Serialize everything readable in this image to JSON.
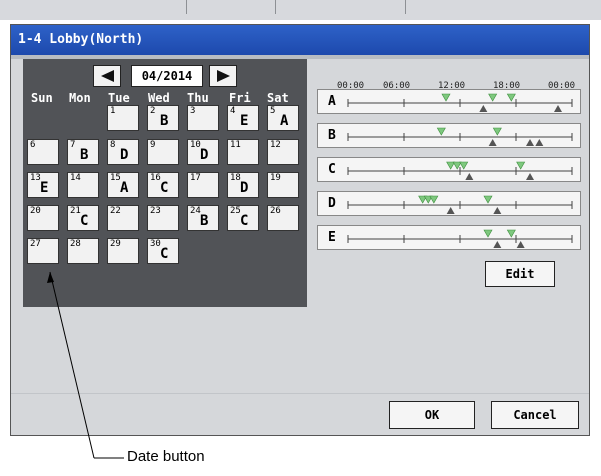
{
  "window": {
    "title": "1-4 Lobby(North)"
  },
  "calendar": {
    "month": "04/2014",
    "prev_icon": "left-triangle-icon",
    "next_icon": "right-triangle-icon",
    "weekdays": [
      "Sun",
      "Mon",
      "Tue",
      "Wed",
      "Thu",
      "Fri",
      "Sat"
    ],
    "days": [
      {
        "num": "1",
        "pattern": ""
      },
      {
        "num": "2",
        "pattern": "B"
      },
      {
        "num": "3",
        "pattern": ""
      },
      {
        "num": "4",
        "pattern": "E"
      },
      {
        "num": "5",
        "pattern": "A"
      },
      {
        "num": "6",
        "pattern": ""
      },
      {
        "num": "7",
        "pattern": "B"
      },
      {
        "num": "8",
        "pattern": "D"
      },
      {
        "num": "9",
        "pattern": ""
      },
      {
        "num": "10",
        "pattern": "D"
      },
      {
        "num": "11",
        "pattern": ""
      },
      {
        "num": "12",
        "pattern": ""
      },
      {
        "num": "13",
        "pattern": "E"
      },
      {
        "num": "14",
        "pattern": ""
      },
      {
        "num": "15",
        "pattern": "A"
      },
      {
        "num": "16",
        "pattern": "C"
      },
      {
        "num": "17",
        "pattern": ""
      },
      {
        "num": "18",
        "pattern": "D"
      },
      {
        "num": "19",
        "pattern": ""
      },
      {
        "num": "20",
        "pattern": ""
      },
      {
        "num": "21",
        "pattern": "C"
      },
      {
        "num": "22",
        "pattern": ""
      },
      {
        "num": "23",
        "pattern": ""
      },
      {
        "num": "24",
        "pattern": "B"
      },
      {
        "num": "25",
        "pattern": "C"
      },
      {
        "num": "26",
        "pattern": ""
      },
      {
        "num": "27",
        "pattern": ""
      },
      {
        "num": "28",
        "pattern": ""
      },
      {
        "num": "29",
        "pattern": ""
      },
      {
        "num": "30",
        "pattern": "C"
      }
    ]
  },
  "schedule": {
    "time_labels": [
      "00:00",
      "06:00",
      "12:00",
      "18:00",
      "00:00"
    ],
    "on_color": "#7ec87e",
    "off_color": "#555555",
    "patterns": [
      {
        "label": "A",
        "on": [
          10.5,
          15.5,
          17.5
        ],
        "off": [
          14.5,
          22.5
        ]
      },
      {
        "label": "B",
        "on": [
          10.0,
          16.0
        ],
        "off": [
          15.5,
          19.5,
          20.5
        ]
      },
      {
        "label": "C",
        "on": [
          11.0,
          11.7,
          12.4,
          18.5
        ],
        "off": [
          13.0,
          19.5
        ]
      },
      {
        "label": "D",
        "on": [
          8.0,
          8.6,
          9.2,
          15.0
        ],
        "off": [
          11.0,
          16.0
        ]
      },
      {
        "label": "E",
        "on": [
          15.0,
          17.5
        ],
        "off": [
          16.0,
          18.5
        ]
      }
    ],
    "edit_label": "Edit"
  },
  "footer": {
    "ok_label": "OK",
    "cancel_label": "Cancel"
  },
  "annotation": {
    "label": "Date button"
  }
}
